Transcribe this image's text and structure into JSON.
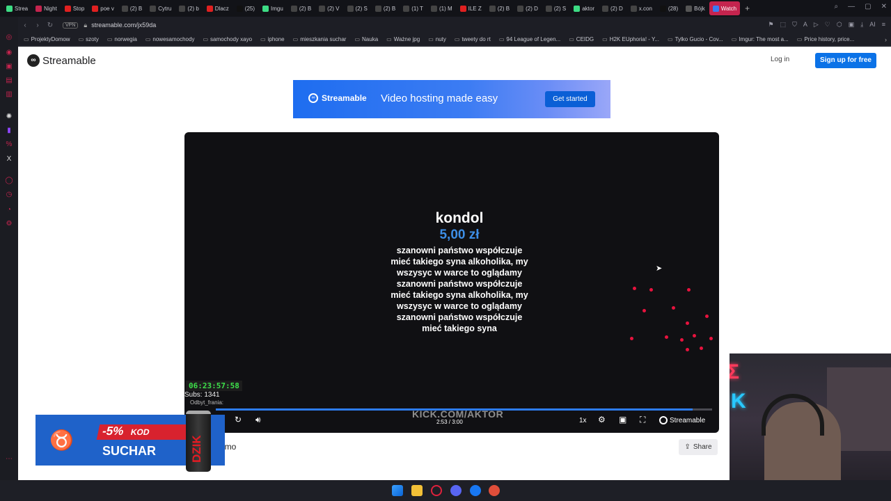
{
  "browser": {
    "tabs": [
      {
        "label": "Strea",
        "icon_color": "#3ddc84"
      },
      {
        "label": "Night",
        "icon_color": "#c5244e"
      },
      {
        "label": "Stop",
        "icon_color": "#e02020"
      },
      {
        "label": "poe v",
        "icon_color": "#e02020"
      },
      {
        "label": "(2) B",
        "icon_color": "#444"
      },
      {
        "label": "Cytru",
        "icon_color": "#444"
      },
      {
        "label": "(2) b",
        "icon_color": "#444"
      },
      {
        "label": "Dlacz",
        "icon_color": "#e02020"
      },
      {
        "label": "(25)",
        "icon_color": "#111"
      },
      {
        "label": "Imgu",
        "icon_color": "#3ddc84"
      },
      {
        "label": "(2) B",
        "icon_color": "#444"
      },
      {
        "label": "(2) V",
        "icon_color": "#444"
      },
      {
        "label": "(2) S",
        "icon_color": "#444"
      },
      {
        "label": "(2) B",
        "icon_color": "#444"
      },
      {
        "label": "(1) T",
        "icon_color": "#444"
      },
      {
        "label": "(1) M",
        "icon_color": "#444"
      },
      {
        "label": "ILE Z",
        "icon_color": "#e02020"
      },
      {
        "label": "(2) B",
        "icon_color": "#444"
      },
      {
        "label": "(2) D",
        "icon_color": "#444"
      },
      {
        "label": "(2) S",
        "icon_color": "#444"
      },
      {
        "label": "aktor",
        "icon_color": "#3ddc84"
      },
      {
        "label": "(2) D",
        "icon_color": "#444"
      },
      {
        "label": "x.con",
        "icon_color": "#444"
      },
      {
        "label": "(28)",
        "icon_color": "#111"
      },
      {
        "label": "Bójk",
        "icon_color": "#555"
      },
      {
        "label": "Watch",
        "icon_color": "#3a7bf2",
        "active": true
      }
    ],
    "url": "streamable.com/jx59da",
    "vpn_label": "VPN",
    "bookmarks": [
      "ProjektyDomow",
      "szoty",
      "norwegia",
      "nowesamochody",
      "samochody xayo",
      "iphone",
      "mieszkania suchar",
      "Nauka",
      "Ważne jpg",
      "nuty",
      "tweety do rt",
      "94 League of Legen...",
      "CEIDG",
      "H2K EUphoria! - Y...",
      "Tylko Gucio - Cov...",
      "Imgur: The most a...",
      "Price history, price..."
    ]
  },
  "site": {
    "logo_text": "Streamable",
    "login_label": "Log in",
    "signup_label": "Sign up for free",
    "banner": {
      "logo_text": "Streamable",
      "tagline": "Video hosting made easy",
      "cta_label": "Get started"
    },
    "video_title_partial": "emo",
    "share_label": "Share"
  },
  "video": {
    "donation": {
      "user": "kondol",
      "amount": "5,00 zł",
      "message": "szanowni państwo współczuje mieć takiego syna alkoholika, my wszysyc w warce to oglądamy szanowni państwo współczuje mieć takiego syna alkoholika, my wszysyc w warce to oglądamy szanowni państwo współczuje mieć takiego syna"
    },
    "stream_timer": "06:23:57:58",
    "subs_text": "Subs: 1341",
    "chat_user": "Odbyt_frania:",
    "watermark": "KICK.COM/AKTOR",
    "time_display": "2:53 / 3:00",
    "progress_fraction": 0.961,
    "speed_label": "1x",
    "brand_label": "Streamable"
  },
  "promo": {
    "discount": "-5%",
    "code_label": "KOD",
    "code": "SUCHAR",
    "can_text": "DZIK"
  }
}
